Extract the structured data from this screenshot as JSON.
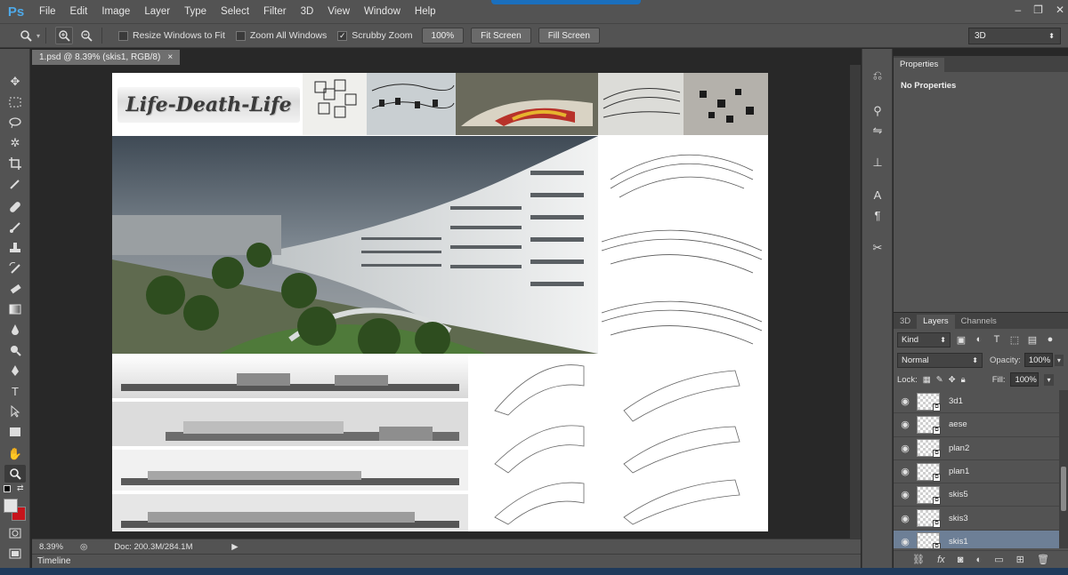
{
  "app": {
    "logo_text": "Ps",
    "menu": [
      "File",
      "Edit",
      "Image",
      "Layer",
      "Type",
      "Select",
      "Filter",
      "3D",
      "View",
      "Window",
      "Help"
    ],
    "window_controls": [
      "–",
      "❐",
      "✕"
    ]
  },
  "options_bar": {
    "resize_windows_label": "Resize Windows to Fit",
    "resize_windows_checked": false,
    "zoom_all_label": "Zoom All Windows",
    "zoom_all_checked": false,
    "scrubby_zoom_label": "Scrubby Zoom",
    "scrubby_zoom_checked": true,
    "btn_100": "100%",
    "btn_fit": "Fit Screen",
    "btn_fill": "Fill Screen",
    "workspace": "3D"
  },
  "document": {
    "tab_title": "1.psd @ 8.39% (skis1, RGB/8)",
    "close_glyph": "×",
    "zoom": "8.39%",
    "doc_size": "Doc: 200.3M/284.1M",
    "artboard_title": "Life-Death-Life"
  },
  "timeline": {
    "label": "Timeline"
  },
  "properties": {
    "tab_label": "Properties",
    "body_text": "No Properties"
  },
  "layers": {
    "tabs": [
      "3D",
      "Layers",
      "Channels"
    ],
    "active_tab": "Layers",
    "kind_label": "Kind",
    "blend_mode": "Normal",
    "opacity_label": "Opacity:",
    "opacity_value": "100%",
    "lock_label": "Lock:",
    "fill_label": "Fill:",
    "fill_value": "100%",
    "items": [
      {
        "name": "3d1",
        "selected": false
      },
      {
        "name": "aese",
        "selected": false
      },
      {
        "name": "plan2",
        "selected": false
      },
      {
        "name": "plan1",
        "selected": false
      },
      {
        "name": "skis5",
        "selected": false
      },
      {
        "name": "skis3",
        "selected": false
      },
      {
        "name": "skis1",
        "selected": true
      }
    ]
  },
  "icons": {
    "zoom_tool": "magnifier-icon",
    "eye": "eye-icon"
  }
}
